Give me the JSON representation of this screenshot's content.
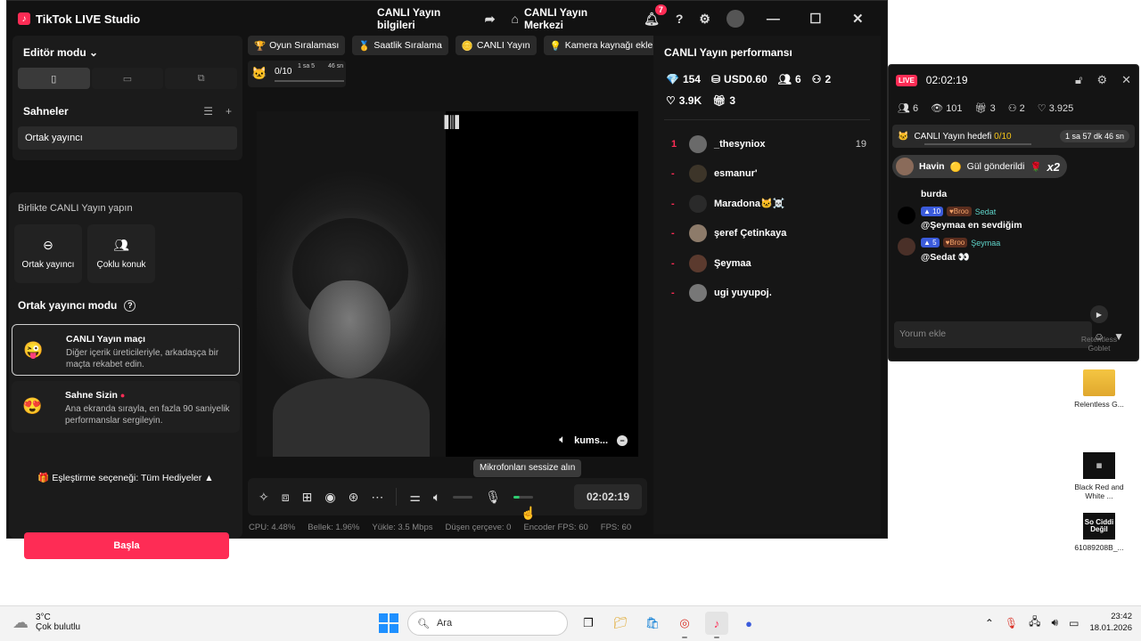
{
  "window": {
    "app_title": "TikTok LIVE Studio",
    "live_info": "CANLI Yayın bilgileri",
    "live_center": "CANLI Yayın Merkezi",
    "notifications_count": "7"
  },
  "left": {
    "editor_mode": "Editör modu",
    "scenes_label": "Sahneler",
    "scene_item": "Ortak yayıncı",
    "together_title": "Birlikte CANLI Yayın yapın",
    "tile_cohost": "Ortak yayıncı",
    "tile_multi": "Çoklu konuk",
    "cohost_mode_title": "Ortak yayıncı modu",
    "match_title": "CANLI Yayın maçı",
    "match_desc": "Diğer içerik üreticileriyle, arkadaşça bir maçta rekabet edin.",
    "stage_title": "Sahne Sizin",
    "stage_desc": "Ana ekranda sırayla, en fazla 90 saniyelik performanslar sergileyin.",
    "pairing": "Eşleştirme seçeneği: Tüm Hediyeler",
    "start_button": "Başla"
  },
  "center": {
    "chips": [
      "Oyun Sıralaması",
      "Saatlik Sıralama",
      "CANLI Yayın",
      "Kamera kaynağı ekle..."
    ],
    "goal_value": "0/10",
    "goal_time_1": "1 sa 5",
    "goal_time_2": "46 sn",
    "audio_source": "kums...",
    "tooltip": "Mikrofonları sessize alın",
    "timer": "02:02:19",
    "stats": {
      "cpu": "CPU: 4.48%",
      "mem": "Bellek: 1.96%",
      "load": "Yükle: 3.5 Mbps",
      "dropped": "Düşen çerçeve: 0",
      "encoder": "Encoder FPS: 60",
      "fps": "FPS: 60"
    }
  },
  "perf": {
    "title": "CANLI Yayın performansı",
    "diamonds": "154",
    "usd": "USD0.60",
    "viewers": "6",
    "new_followers": "2",
    "likes": "3.9K",
    "gifts": "3",
    "viewers_list": [
      {
        "rank": "1",
        "name": "_thesyniox",
        "score": "19"
      },
      {
        "rank": "-",
        "name": "esmanur'",
        "score": ""
      },
      {
        "rank": "-",
        "name": "Maradona🐱☠️",
        "score": ""
      },
      {
        "rank": "-",
        "name": "şeref Çetinkaya",
        "score": ""
      },
      {
        "rank": "-",
        "name": "Şeymaa",
        "score": ""
      },
      {
        "rank": "-",
        "name": "ugi yuyupoj.",
        "score": ""
      }
    ]
  },
  "overlay": {
    "live": "LIVE",
    "time": "02:02:19",
    "viewers": "6",
    "views": "101",
    "gifts": "3",
    "followers": "2",
    "likes": "3.925",
    "goal_label": "CANLI Yayın hedefi ",
    "goal_value": "0/10",
    "goal_time": "1 sa 57 dk 46 sn",
    "gift_user": "Havin",
    "gift_text": "Gül gönderildi",
    "gift_mult": "x2",
    "msg0": "burda",
    "msg1_level": "10",
    "msg1_fan": "Broo",
    "msg1_user": "Sedat",
    "msg1_text": "@Şeymaa en sevdiğim",
    "msg2_level": "5",
    "msg2_fan": "Broo",
    "msg2_user": "Şeymaa",
    "msg2_text": "@Sedat 👀",
    "input_placeholder": "Yorum ekle"
  },
  "desktop": {
    "icon0": "Relentless G...",
    "icon1": "Black Red and White ...",
    "icon2": "61089208B_...",
    "thumb_sc": "So Ciddi Değil",
    "partial": "Retentless Goblet"
  },
  "taskbar": {
    "temp": "3°C",
    "weather": "Çok bulutlu",
    "search": "Ara",
    "time": "23:42",
    "date": "18.01.2026"
  }
}
